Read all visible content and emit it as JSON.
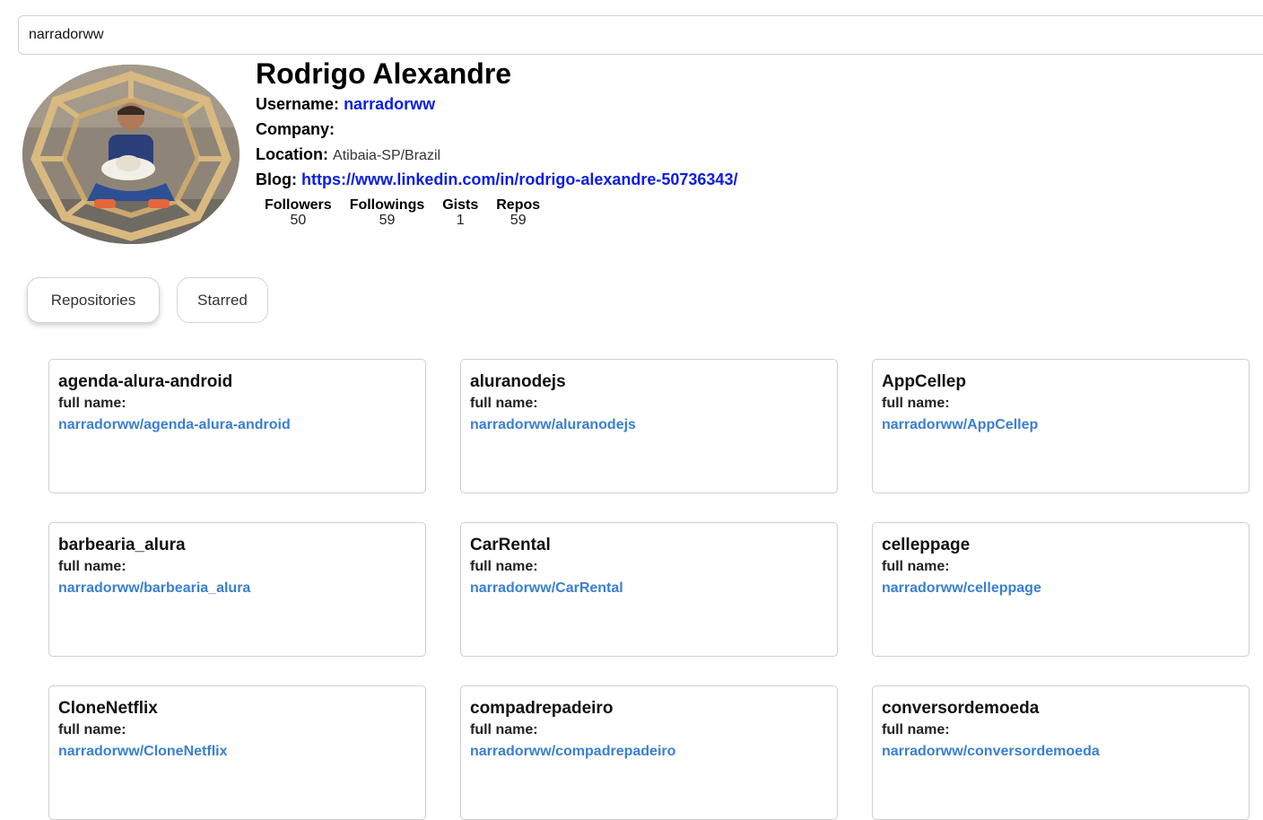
{
  "search": {
    "value": "narradorww"
  },
  "profile": {
    "name": "Rodrigo Alexandre",
    "username_label": "Username:",
    "username": "narradorww",
    "company_label": "Company:",
    "company": "",
    "location_label": "Location:",
    "location": "Atibaia-SP/Brazil",
    "blog_label": "Blog:",
    "blog": "https://www.linkedin.com/in/rodrigo-alexandre-50736343/"
  },
  "stats": [
    {
      "label": "Followers",
      "value": "50"
    },
    {
      "label": "Followings",
      "value": "59"
    },
    {
      "label": "Gists",
      "value": "1"
    },
    {
      "label": "Repos",
      "value": "59"
    }
  ],
  "tabs": {
    "repositories": "Repositories",
    "starred": "Starred"
  },
  "repos": [
    {
      "name": "agenda-alura-android",
      "fullname_label": "full name:",
      "fullname": "narradorww/agenda-alura-android"
    },
    {
      "name": "aluranodejs",
      "fullname_label": "full name:",
      "fullname": "narradorww/aluranodejs"
    },
    {
      "name": "AppCellep",
      "fullname_label": "full name:",
      "fullname": "narradorww/AppCellep"
    },
    {
      "name": "barbearia_alura",
      "fullname_label": "full name:",
      "fullname": "narradorww/barbearia_alura"
    },
    {
      "name": "CarRental",
      "fullname_label": "full name:",
      "fullname": "narradorww/CarRental"
    },
    {
      "name": "celleppage",
      "fullname_label": "full name:",
      "fullname": "narradorww/celleppage"
    },
    {
      "name": "CloneNetflix",
      "fullname_label": "full name:",
      "fullname": "narradorww/CloneNetflix"
    },
    {
      "name": "compadrepadeiro",
      "fullname_label": "full name:",
      "fullname": "narradorww/compadrepadeiro"
    },
    {
      "name": "conversordemoeda",
      "fullname_label": "full name:",
      "fullname": "narradorww/conversordemoeda"
    }
  ]
}
